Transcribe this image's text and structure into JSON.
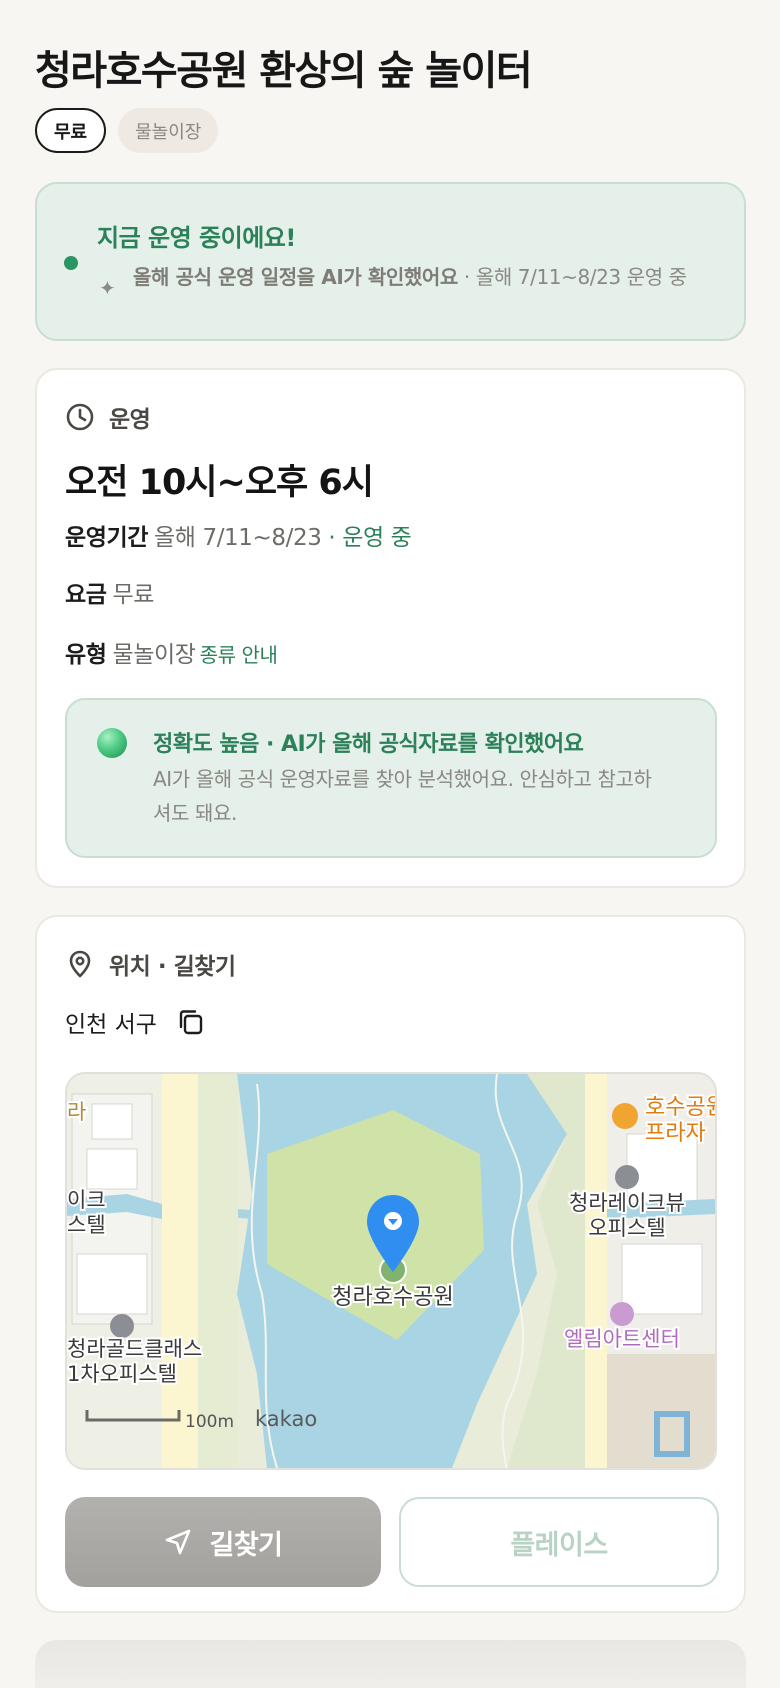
{
  "title": "청라호수공원 환상의 숲 놀이터",
  "chips": {
    "active": "무료",
    "tag": "물놀이장"
  },
  "status": {
    "title": "지금 운영 중이에요!",
    "ai_check": "올해 공식 운영 일정을 AI가 확인했어요",
    "detail": "· 올해 7/11~8/23 운영 중"
  },
  "hours": {
    "section_label": "운영",
    "main": "오전 10시~오후 6시",
    "period_key": "운영기간",
    "period_value": "올해 7/11~8/23",
    "period_status": "· 운영 중",
    "fee_key": "요금",
    "fee_value": "무료",
    "type_key": "유형",
    "type_value": "물놀이장",
    "type_link": "종류 안내"
  },
  "accuracy": {
    "title": "정확도 높음 · AI가 올해 공식자료를 확인했어요",
    "desc": "AI가 올해 공식 운영자료를 찾아 분석했어요. 안심하고 참고하셔도 돼요."
  },
  "location": {
    "section_label": "위치 · 길찾기",
    "address": "인천 서구"
  },
  "map": {
    "center_label": "청라호수공원",
    "poi_plaza": [
      "호수공원",
      "프라자"
    ],
    "poi_lakeview": [
      "청라레이크뷰",
      "오피스텔"
    ],
    "poi_art": "엘림아트센터",
    "poi_gold": [
      "청라골드클래스",
      "1차오피스텔"
    ],
    "poi_left_top": "라",
    "poi_left_mid": [
      "이크",
      "스텔"
    ],
    "scale": "100m",
    "brand": "kakao"
  },
  "buttons": {
    "navigate": "길찾기",
    "place": "플레이스"
  },
  "colors": {
    "accent_green": "#2b8158",
    "status_bg": "#e6f0ea",
    "page_bg": "#f7f6f2"
  }
}
